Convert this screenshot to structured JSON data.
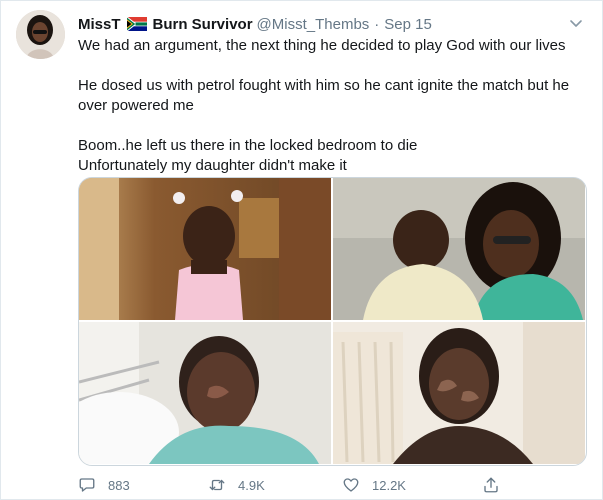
{
  "author": {
    "name": "MissT",
    "name_suffix": "Burn Survivor",
    "handle": "@Misst_Thembs",
    "separator": "·",
    "date": "Sep 15"
  },
  "tweet": {
    "lines": [
      "We had an argument,  the next thing he decided to play God with our lives",
      "He dosed us with petrol fought with him so he cant ignite the match but he over powered me",
      "Boom..he left us there in the locked bedroom to die",
      "Unfortunately my daughter didn't make it"
    ]
  },
  "media": {
    "photos": [
      {
        "name": "child-photo"
      },
      {
        "name": "mother-baby-photo"
      },
      {
        "name": "hospital-photo"
      },
      {
        "name": "recovery-photo"
      }
    ]
  },
  "actions": {
    "replies": "883",
    "retweets": "4.9K",
    "likes": "12.2K"
  },
  "icons": {
    "flag": "south-africa-flag-icon",
    "caret": "chevron-down-icon",
    "reply": "reply-icon",
    "retweet": "retweet-icon",
    "like": "heart-icon",
    "share": "share-icon"
  },
  "colors": {
    "text": "#14171a",
    "muted": "#657786",
    "border": "#e1e8ed"
  }
}
